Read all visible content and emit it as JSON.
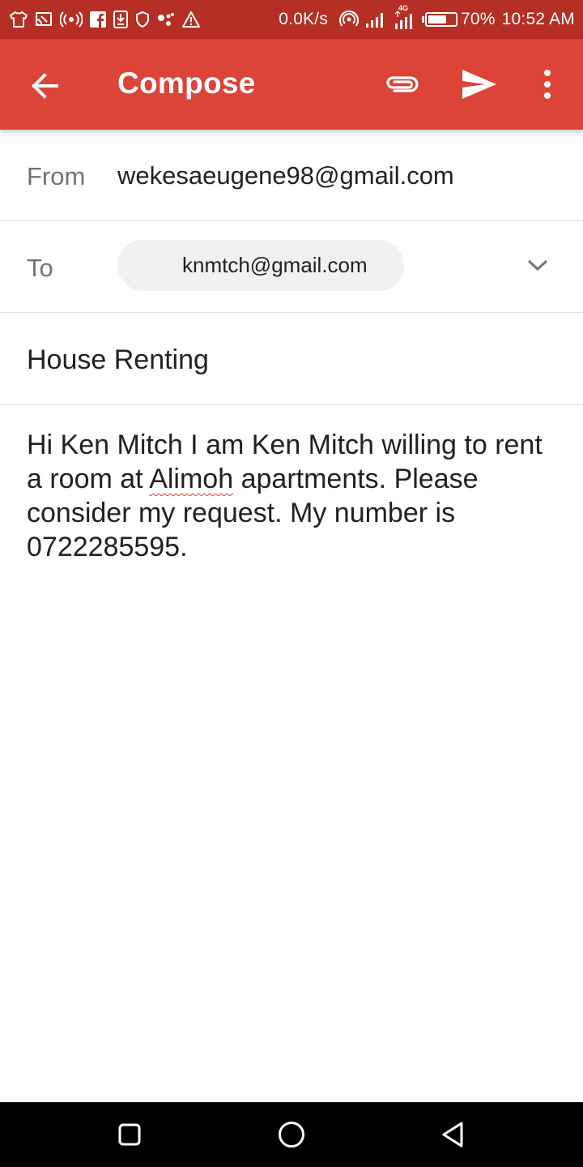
{
  "status_bar": {
    "network_speed": "0.0K/s",
    "network_type": "4G",
    "battery_percent": "70%",
    "time": "10:52 AM",
    "battery_level": 0.7,
    "icons": [
      "tshirt-icon",
      "cast-icon",
      "radio-icon",
      "facebook-icon",
      "download-icon",
      "shield-icon",
      "assistant-icon",
      "warning-icon",
      "hotspot-icon",
      "signal-icon",
      "signal-4g-icon",
      "battery-icon"
    ]
  },
  "app_bar": {
    "title": "Compose",
    "background": "#db4437",
    "actions": [
      "back-arrow-icon",
      "attach-icon",
      "send-icon",
      "more-vert-icon"
    ]
  },
  "compose": {
    "from_label": "From",
    "from_value": "wekesaeugene98@gmail.com",
    "to_label": "To",
    "to_chip": "knmtch@gmail.com",
    "subject": "House Renting",
    "body": {
      "part1": "Hi Ken Mitch I am Ken Mitch willing to rent a room at ",
      "misspelled": "Alimoh",
      "part2": " apartments. Please consider my request. My number is 0722285595."
    }
  },
  "nav_bar": {
    "buttons": [
      "recents-icon",
      "home-icon",
      "back-triangle-icon"
    ]
  }
}
